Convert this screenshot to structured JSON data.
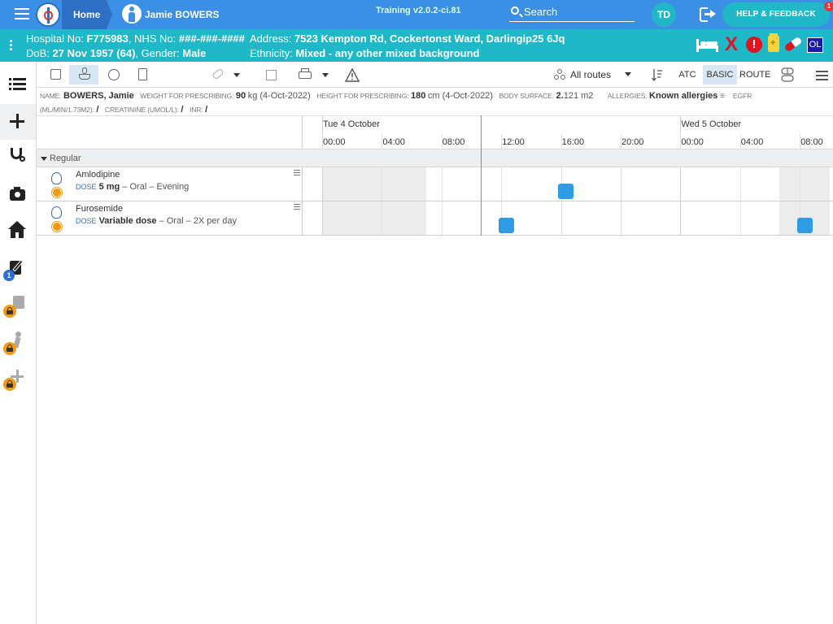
{
  "header": {
    "home_label": "Home",
    "patient_name": "Jamie BOWERS",
    "build": "Training v2.0.2-ci.81",
    "search_label": "Search",
    "user_initials": "TD",
    "help_label": "HELP & FEEDBACK",
    "help_badge": "1"
  },
  "banner": {
    "hospital_no_label": "Hospital No:",
    "hospital_no": "F775983",
    "nhs_no_label": "NHS No:",
    "nhs_no": "###-###-####",
    "address_label": "Address:",
    "address": "7523 Kempton Rd, Cockertonst Ward, Darlingip25 6Jq",
    "dob_label": "DoB:",
    "dob": "27 Nov 1957 (64)",
    "gender_label": "Gender:",
    "gender": "Male",
    "ethnicity_label": "Ethnicity:",
    "ethnicity": "Mixed - any other mixed background",
    "ol_badge": "OL",
    "alert_symbol": "!",
    "x_symbol": "X"
  },
  "leftnav": {
    "notes_badge": "1"
  },
  "toolbar": {
    "routes_label": "All routes",
    "view_atc": "ATC",
    "view_basic": "BASIC",
    "view_route": "ROUTE"
  },
  "info": {
    "name_label": "NAME:",
    "name": "BOWERS, Jamie",
    "weight_label": "WEIGHT FOR PRESCRIBING:",
    "weight_value": "90",
    "weight_unit": "kg (4-Oct-2022)",
    "height_label": "HEIGHT FOR PRESCRIBING:",
    "height_value": "180",
    "height_unit": "cm (4-Oct-2022)",
    "bsa_label": "BODY SURFACE:",
    "bsa_value": "2.",
    "bsa_unit": "121 m2",
    "allergies_label": "ALLERGIES:",
    "allergies": "Known allergies",
    "egfr_label": "EGFR",
    "egfr_unit": "(ML/MIN/1.73M2):",
    "egfr_value": "/",
    "creat_label": "CREATININE (UMOL/L):",
    "creat_value": "/",
    "inr_label": "INR:",
    "inr_value": "/"
  },
  "timeline": {
    "days": [
      "Tue 4 October",
      "Wed 5 October"
    ],
    "times": [
      "00:00",
      "04:00",
      "08:00",
      "12:00",
      "16:00",
      "20:00",
      "00:00",
      "04:00",
      "08:00"
    ],
    "group_label": "Regular",
    "medications": [
      {
        "name": "Amlodipine",
        "dose_label": "DOSE",
        "dose": "5 mg",
        "rest": " – Oral – Evening",
        "admin_hours": [
          16.3
        ]
      },
      {
        "name": "Furosemide",
        "dose_label": "DOSE",
        "dose": "Variable dose",
        "rest": " – Oral – 2X per day",
        "admin_hours": [
          12.3,
          32.3
        ]
      }
    ]
  }
}
